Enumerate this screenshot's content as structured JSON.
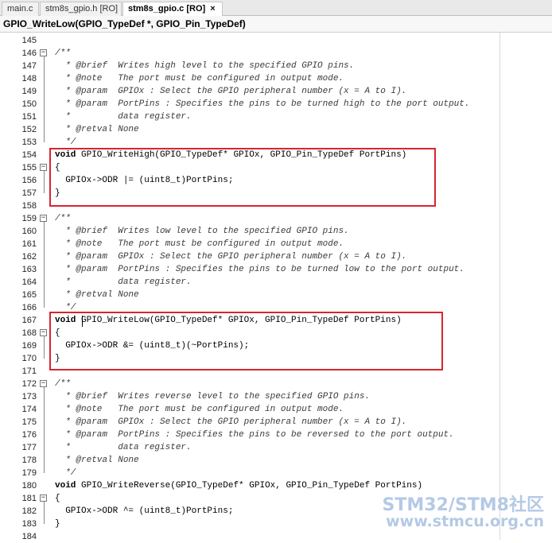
{
  "tabs": [
    {
      "label": "main.c",
      "active": false
    },
    {
      "label": "stm8s_gpio.h [RO]",
      "active": false
    },
    {
      "label": "stm8s_gpio.c [RO]",
      "active": true,
      "close": "×"
    }
  ],
  "function_bar": {
    "text": "GPIO_WriteLow(GPIO_TypeDef *, GPIO_Pin_TypeDef)"
  },
  "code_lines": [
    {
      "n": "145",
      "fold": "",
      "text": ""
    },
    {
      "n": "146",
      "fold": "−",
      "text": "/**",
      "style": "cm"
    },
    {
      "n": "147",
      "fold": "",
      "text": "  * @brief  Writes high level to the specified GPIO pins.",
      "style": "cm"
    },
    {
      "n": "148",
      "fold": "",
      "text": "  * @note   The port must be configured in output mode.",
      "style": "cm"
    },
    {
      "n": "149",
      "fold": "",
      "text": "  * @param  GPIOx : Select the GPIO peripheral number (x = A to I).",
      "style": "cm"
    },
    {
      "n": "150",
      "fold": "",
      "text": "  * @param  PortPins : Specifies the pins to be turned high to the port output.",
      "style": "cm"
    },
    {
      "n": "151",
      "fold": "",
      "text": "  *         data register.",
      "style": "cm"
    },
    {
      "n": "152",
      "fold": "",
      "text": "  * @retval None",
      "style": "cm"
    },
    {
      "n": "153",
      "fold": "",
      "text": "  */",
      "style": "cm"
    },
    {
      "n": "154",
      "fold": "",
      "kw": "void",
      "text": " GPIO_WriteHigh(GPIO_TypeDef* GPIOx, GPIO_Pin_TypeDef PortPins)"
    },
    {
      "n": "155",
      "fold": "−",
      "text": "{"
    },
    {
      "n": "156",
      "fold": "",
      "text": "  GPIOx->ODR |= (uint8_t)PortPins;"
    },
    {
      "n": "157",
      "fold": "",
      "text": "}"
    },
    {
      "n": "158",
      "fold": "",
      "text": ""
    },
    {
      "n": "159",
      "fold": "−",
      "text": "/**",
      "style": "cm"
    },
    {
      "n": "160",
      "fold": "",
      "text": "  * @brief  Writes low level to the specified GPIO pins.",
      "style": "cm"
    },
    {
      "n": "161",
      "fold": "",
      "text": "  * @note   The port must be configured in output mode.",
      "style": "cm"
    },
    {
      "n": "162",
      "fold": "",
      "text": "  * @param  GPIOx : Select the GPIO peripheral number (x = A to I).",
      "style": "cm"
    },
    {
      "n": "163",
      "fold": "",
      "text": "  * @param  PortPins : Specifies the pins to be turned low to the port output.",
      "style": "cm"
    },
    {
      "n": "164",
      "fold": "",
      "text": "  *         data register.",
      "style": "cm"
    },
    {
      "n": "165",
      "fold": "",
      "text": "  * @retval None",
      "style": "cm"
    },
    {
      "n": "166",
      "fold": "",
      "text": "  */",
      "style": "cm"
    },
    {
      "n": "167",
      "fold": "",
      "kw": "void",
      "text": " GPIO_WriteLow(GPIO_TypeDef* GPIOx, GPIO_Pin_TypeDef PortPins)"
    },
    {
      "n": "168",
      "fold": "−",
      "text": "{"
    },
    {
      "n": "169",
      "fold": "",
      "text": "  GPIOx->ODR &= (uint8_t)(~PortPins);"
    },
    {
      "n": "170",
      "fold": "",
      "text": "}"
    },
    {
      "n": "171",
      "fold": "",
      "text": ""
    },
    {
      "n": "172",
      "fold": "−",
      "text": "/**",
      "style": "cm"
    },
    {
      "n": "173",
      "fold": "",
      "text": "  * @brief  Writes reverse level to the specified GPIO pins.",
      "style": "cm"
    },
    {
      "n": "174",
      "fold": "",
      "text": "  * @note   The port must be configured in output mode.",
      "style": "cm"
    },
    {
      "n": "175",
      "fold": "",
      "text": "  * @param  GPIOx : Select the GPIO peripheral number (x = A to I).",
      "style": "cm"
    },
    {
      "n": "176",
      "fold": "",
      "text": "  * @param  PortPins : Specifies the pins to be reversed to the port output.",
      "style": "cm"
    },
    {
      "n": "177",
      "fold": "",
      "text": "  *         data register.",
      "style": "cm"
    },
    {
      "n": "178",
      "fold": "",
      "text": "  * @retval None",
      "style": "cm"
    },
    {
      "n": "179",
      "fold": "",
      "text": "  */",
      "style": "cm"
    },
    {
      "n": "180",
      "fold": "",
      "kw": "void",
      "text": " GPIO_WriteReverse(GPIO_TypeDef* GPIOx, GPIO_Pin_TypeDef PortPins)"
    },
    {
      "n": "181",
      "fold": "−",
      "text": "{"
    },
    {
      "n": "182",
      "fold": "",
      "text": "  GPIOx->ODR ^= (uint8_t)PortPins;"
    },
    {
      "n": "183",
      "fold": "",
      "text": "}"
    },
    {
      "n": "184",
      "fold": "",
      "text": ""
    }
  ],
  "watermark": {
    "line1": "STM32/STM8社区",
    "line2": "www.stmcu.org.cn"
  },
  "colors": {
    "highlight_box": "#d7262e",
    "watermark": "#b4c9e6"
  }
}
